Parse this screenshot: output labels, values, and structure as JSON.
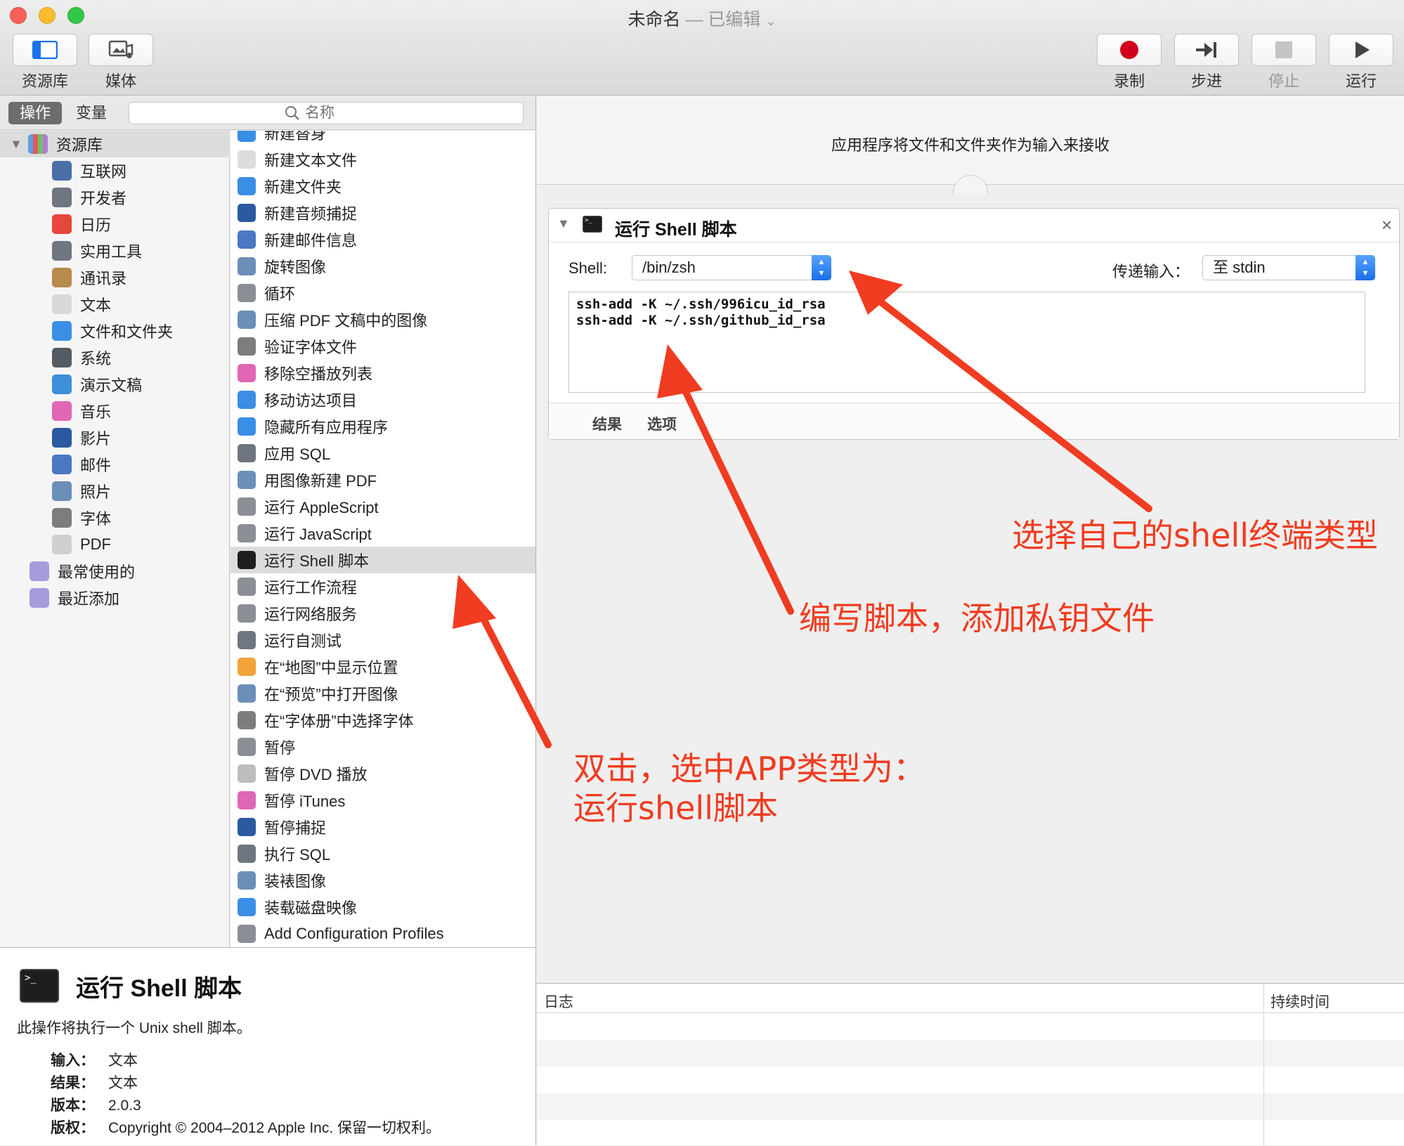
{
  "window": {
    "title": "未命名",
    "edited": "— 已编辑",
    "title_chevron": "⌄"
  },
  "toolbar": {
    "library_label": "资源库",
    "media_label": "媒体",
    "record_label": "录制",
    "step_label": "步进",
    "stop_label": "停止",
    "run_label": "运行"
  },
  "left_toolbar": {
    "actions_tab": "操作",
    "variables_tab": "变量",
    "search_placeholder": "名称"
  },
  "library": {
    "root_label": "资源库",
    "items": [
      {
        "label": "互联网",
        "icon": "globe-icon",
        "color": "#4a6ea8"
      },
      {
        "label": "开发者",
        "icon": "tools-icon",
        "color": "#6f7680"
      },
      {
        "label": "日历",
        "icon": "calendar-icon",
        "color": "#e7463c"
      },
      {
        "label": "实用工具",
        "icon": "tools-icon",
        "color": "#6f7680"
      },
      {
        "label": "通讯录",
        "icon": "contacts-icon",
        "color": "#b78a4e"
      },
      {
        "label": "文本",
        "icon": "text-doc-icon",
        "color": "#d8d8d8"
      },
      {
        "label": "文件和文件夹",
        "icon": "finder-icon",
        "color": "#3a8ee6"
      },
      {
        "label": "系统",
        "icon": "system-gear-icon",
        "color": "#555b63"
      },
      {
        "label": "演示文稿",
        "icon": "keynote-icon",
        "color": "#3c8fd8"
      },
      {
        "label": "音乐",
        "icon": "music-icon",
        "color": "#e067b5"
      },
      {
        "label": "影片",
        "icon": "quicktime-icon",
        "color": "#2a5aa0"
      },
      {
        "label": "邮件",
        "icon": "mail-icon",
        "color": "#4a78c2"
      },
      {
        "label": "照片",
        "icon": "photo-icon",
        "color": "#6b8fb8"
      },
      {
        "label": "字体",
        "icon": "font-book-icon",
        "color": "#7d7d7d"
      },
      {
        "label": "PDF",
        "icon": "pdf-icon",
        "color": "#cfcfcf"
      }
    ],
    "smart_groups": [
      {
        "label": "最常使用的",
        "icon": "smart-folder-icon",
        "color": "#a89bdc"
      },
      {
        "label": "最近添加",
        "icon": "smart-folder-icon",
        "color": "#a89bdc"
      }
    ]
  },
  "actions": {
    "items": [
      {
        "label": "新建替身",
        "icon": "finder-icon",
        "color": "#3a8ee6"
      },
      {
        "label": "新建文本文件",
        "icon": "text-doc-icon",
        "color": "#dcdcdc"
      },
      {
        "label": "新建文件夹",
        "icon": "finder-icon",
        "color": "#3a8ee6"
      },
      {
        "label": "新建音频捕捉",
        "icon": "quicktime-icon",
        "color": "#2a5aa0"
      },
      {
        "label": "新建邮件信息",
        "icon": "mail-icon",
        "color": "#4a78c2"
      },
      {
        "label": "旋转图像",
        "icon": "preview-icon",
        "color": "#6b8fb8"
      },
      {
        "label": "循环",
        "icon": "automator-icon",
        "color": "#8a8f96"
      },
      {
        "label": "压缩 PDF 文稿中的图像",
        "icon": "preview-icon",
        "color": "#6b8fb8"
      },
      {
        "label": "验证字体文件",
        "icon": "font-book-icon",
        "color": "#7d7d7d"
      },
      {
        "label": "移除空播放列表",
        "icon": "itunes-icon",
        "color": "#e067b5"
      },
      {
        "label": "移动访达项目",
        "icon": "finder-icon",
        "color": "#3a8ee6"
      },
      {
        "label": "隐藏所有应用程序",
        "icon": "finder-icon",
        "color": "#3a8ee6"
      },
      {
        "label": "应用 SQL",
        "icon": "tools-icon",
        "color": "#6f7680"
      },
      {
        "label": "用图像新建 PDF",
        "icon": "preview-icon",
        "color": "#6b8fb8"
      },
      {
        "label": "运行 AppleScript",
        "icon": "automator-icon",
        "color": "#8a8f96"
      },
      {
        "label": "运行 JavaScript",
        "icon": "automator-icon",
        "color": "#8a8f96"
      },
      {
        "label": "运行 Shell 脚本",
        "icon": "terminal-icon",
        "color": "#1e1e1e",
        "selected": true
      },
      {
        "label": "运行工作流程",
        "icon": "automator-icon",
        "color": "#8a8f96"
      },
      {
        "label": "运行网络服务",
        "icon": "automator-icon",
        "color": "#8a8f96"
      },
      {
        "label": "运行自测试",
        "icon": "tools-icon",
        "color": "#6f7680"
      },
      {
        "label": "在“地图”中显示位置",
        "icon": "photos-icon",
        "color": "#f2a33a"
      },
      {
        "label": "在“预览”中打开图像",
        "icon": "preview-icon",
        "color": "#6b8fb8"
      },
      {
        "label": "在“字体册”中选择字体",
        "icon": "font-book-icon",
        "color": "#7d7d7d"
      },
      {
        "label": "暂停",
        "icon": "automator-icon",
        "color": "#8a8f96"
      },
      {
        "label": "暂停 DVD 播放",
        "icon": "dvd-icon",
        "color": "#bdbdbd"
      },
      {
        "label": "暂停 iTunes",
        "icon": "itunes-icon",
        "color": "#e067b5"
      },
      {
        "label": "暂停捕捉",
        "icon": "quicktime-icon",
        "color": "#2a5aa0"
      },
      {
        "label": "执行 SQL",
        "icon": "tools-icon",
        "color": "#6f7680"
      },
      {
        "label": "装裱图像",
        "icon": "preview-icon",
        "color": "#6b8fb8"
      },
      {
        "label": "装载磁盘映像",
        "icon": "finder-icon",
        "color": "#3a8ee6"
      },
      {
        "label": "Add Configuration Profiles",
        "icon": "profile-icon",
        "color": "#8a8f96"
      }
    ]
  },
  "description": {
    "title": "运行 Shell 脚本",
    "text": "此操作将执行一个 Unix shell 脚本。",
    "input_key": "输入：",
    "input_value": "文本",
    "result_key": "结果：",
    "result_value": "文本",
    "version_key": "版本：",
    "version_value": "2.0.3",
    "copyright_key": "版权：",
    "copyright_value": "Copyright © 2004–2012 Apple Inc. 保留一切权利。"
  },
  "workflow": {
    "header": "应用程序将文件和文件夹作为输入来接收",
    "card": {
      "title": "运行 Shell 脚本",
      "close": "×",
      "shell_label": "Shell:",
      "shell_value": "/bin/zsh",
      "pass_label": "传递输入：",
      "pass_value": "至 stdin",
      "script": "ssh-add -K ~/.ssh/996icu_id_rsa\nssh-add -K ~/.ssh/github_id_rsa",
      "results_tab": "结果",
      "options_tab": "选项"
    }
  },
  "log": {
    "col_log": "日志",
    "col_duration": "持续时间"
  },
  "annotations": {
    "shell_type": "选择自己的shell终端类型",
    "write_script": "编写脚本，添加私钥文件",
    "double_click_line1": "双击，选中APP类型为：",
    "double_click_line2": "运行shell脚本",
    "color": "#f03c20"
  }
}
